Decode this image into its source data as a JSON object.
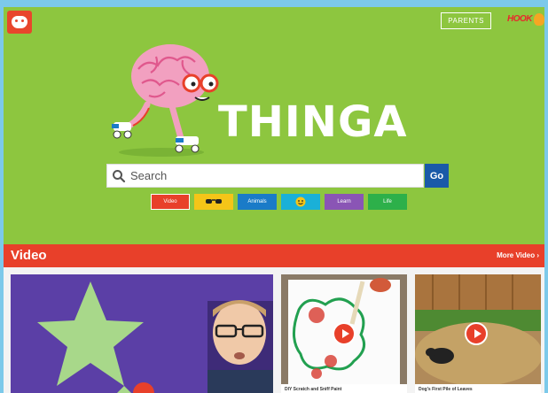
{
  "header": {
    "parents_label": "PARENTS",
    "brand_label": "HOOK"
  },
  "hero": {
    "title": "THINGA"
  },
  "search": {
    "placeholder": "Search",
    "go_label": "Go"
  },
  "categories": [
    {
      "label": "Video",
      "color": "#e8402a"
    },
    {
      "label": "",
      "icon": "sunglasses-icon",
      "color": "#f5c518"
    },
    {
      "label": "Animals",
      "color": "#1a7bc8"
    },
    {
      "label": "",
      "icon": "smiley-icon",
      "color": "#1ab0d8"
    },
    {
      "label": "Learn",
      "color": "#8a55b5"
    },
    {
      "label": "Life",
      "color": "#2db04a"
    }
  ],
  "video_section": {
    "title": "Video",
    "more_label": "More Video ›",
    "thumbnails": [
      {
        "caption": "DIY Scratch and Sniff Paint"
      },
      {
        "caption": "Dog's First Pile of Leaves"
      }
    ]
  },
  "colors": {
    "background": "#8dc63f",
    "accent": "#e8402a",
    "go_button": "#1a5aa8"
  }
}
